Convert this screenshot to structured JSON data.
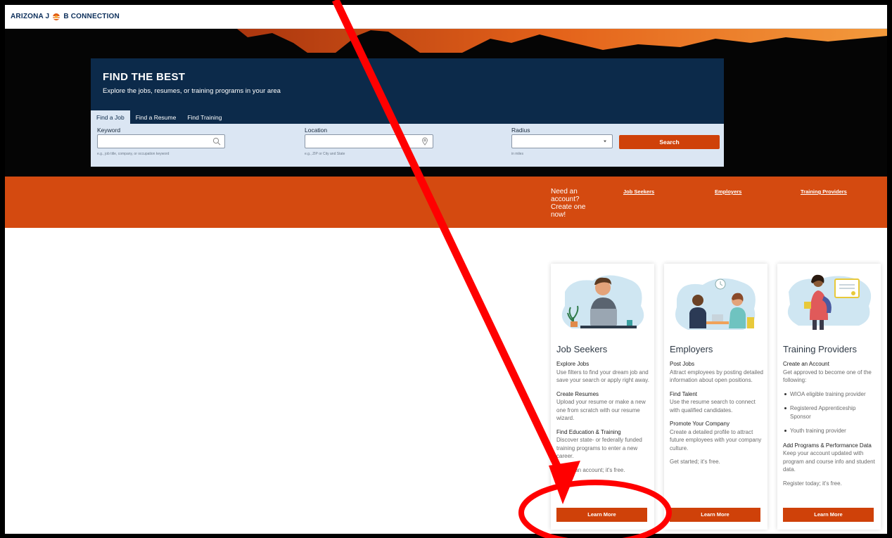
{
  "header": {
    "logo_text_left": "ARIZONA J",
    "logo_text_right": "B CONNECTION"
  },
  "search": {
    "title": "FIND THE BEST",
    "subtitle": "Explore the jobs, resumes, or training programs in your area",
    "tabs": [
      {
        "label": "Find a Job",
        "active": true
      },
      {
        "label": "Find a Resume",
        "active": false
      },
      {
        "label": "Find Training",
        "active": false
      }
    ],
    "keyword": {
      "label": "Keyword",
      "value": "",
      "help": "e.g., job title, company, or occupation keyword"
    },
    "location": {
      "label": "Location",
      "value": "",
      "help": "e.g., ZIP or City and State"
    },
    "radius": {
      "label": "Radius",
      "value": "",
      "help": "in miles"
    },
    "button_label": "Search"
  },
  "band": {
    "need_account": "Need an account? Create one now!",
    "links": [
      "Job Seekers",
      "Employers",
      "Training Providers"
    ]
  },
  "cards": [
    {
      "title": "Job Seekers",
      "sections": [
        {
          "heading": "Explore Jobs",
          "text": "Use filters to find your dream job and save your search or apply right away."
        },
        {
          "heading": "Create Resumes",
          "text": "Upload your resume or make a new one from scratch with our resume wizard."
        },
        {
          "heading": "Find Education & Training",
          "text": "Discover state- or federally funded training programs to enter a new career."
        }
      ],
      "footer": "Create an account; it's free.",
      "button": "Learn More"
    },
    {
      "title": "Employers",
      "sections": [
        {
          "heading": "Post Jobs",
          "text": "Attract employees by posting detailed information about open positions."
        },
        {
          "heading": "Find Talent",
          "text": "Use the resume search to connect with qualified candidates."
        },
        {
          "heading": "Promote Your Company",
          "text": "Create a detailed profile to attract future employees with your company culture."
        }
      ],
      "footer": "Get started; it's free.",
      "button": "Learn More"
    },
    {
      "title": "Training Providers",
      "intro_heading": "Create an Account",
      "intro_text": "Get approved to become one of the following:",
      "bullets": [
        "WIOA eligible training provider",
        "Registered Apprenticeship Sponsor",
        "Youth training provider"
      ],
      "section_heading": "Add Programs & Performance Data",
      "section_text": "Keep your account updated with program and course info and student data.",
      "footer": "Register today; it's free.",
      "button": "Learn More"
    }
  ],
  "colors": {
    "navy": "#0c2a4a",
    "orange": "#d44a10",
    "annotation_red": "#ff0000"
  },
  "icons": [
    "search-icon",
    "location-pin-icon",
    "chevron-down-icon"
  ]
}
